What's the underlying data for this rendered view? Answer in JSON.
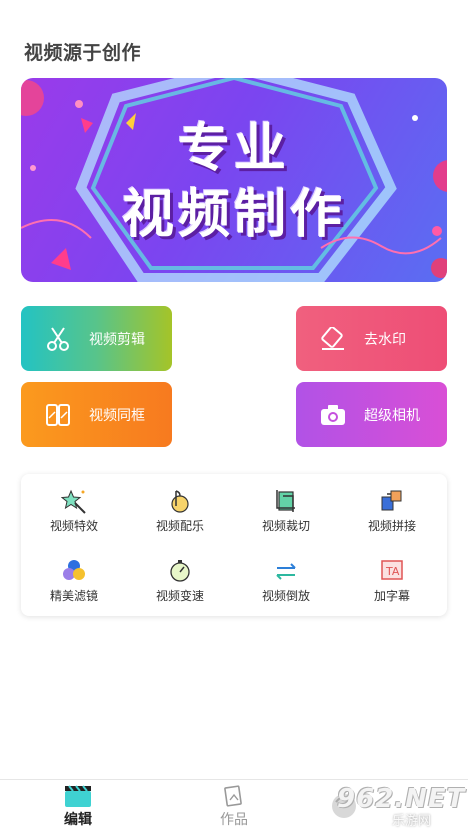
{
  "page_title": "视频源于创作",
  "banner": {
    "line1": "专业",
    "line2": "视频制作"
  },
  "tiles": {
    "cut": "视频剪辑",
    "watermark": "去水印",
    "frame": "视频同框",
    "camera": "超级相机"
  },
  "tools": [
    {
      "label": "视频特效",
      "icon": "magic-star-icon"
    },
    {
      "label": "视频配乐",
      "icon": "music-icon"
    },
    {
      "label": "视频裁切",
      "icon": "crop-icon"
    },
    {
      "label": "视频拼接",
      "icon": "splice-icon"
    },
    {
      "label": "精美滤镜",
      "icon": "filter-icon"
    },
    {
      "label": "视频变速",
      "icon": "speed-icon"
    },
    {
      "label": "视频倒放",
      "icon": "reverse-icon"
    },
    {
      "label": "加字幕",
      "icon": "subtitle-icon"
    }
  ],
  "bottom_nav": {
    "edit": "编辑",
    "works": "作品"
  },
  "watermark": {
    "logo": "962.NET",
    "sub": "乐游网"
  },
  "colors": {
    "cut_tile": "#58c48a",
    "watermark_tile": "#ee4e76",
    "frame_tile": "#f88a1e",
    "camera_tile": "#c550de",
    "banner": "#7b45f0"
  }
}
